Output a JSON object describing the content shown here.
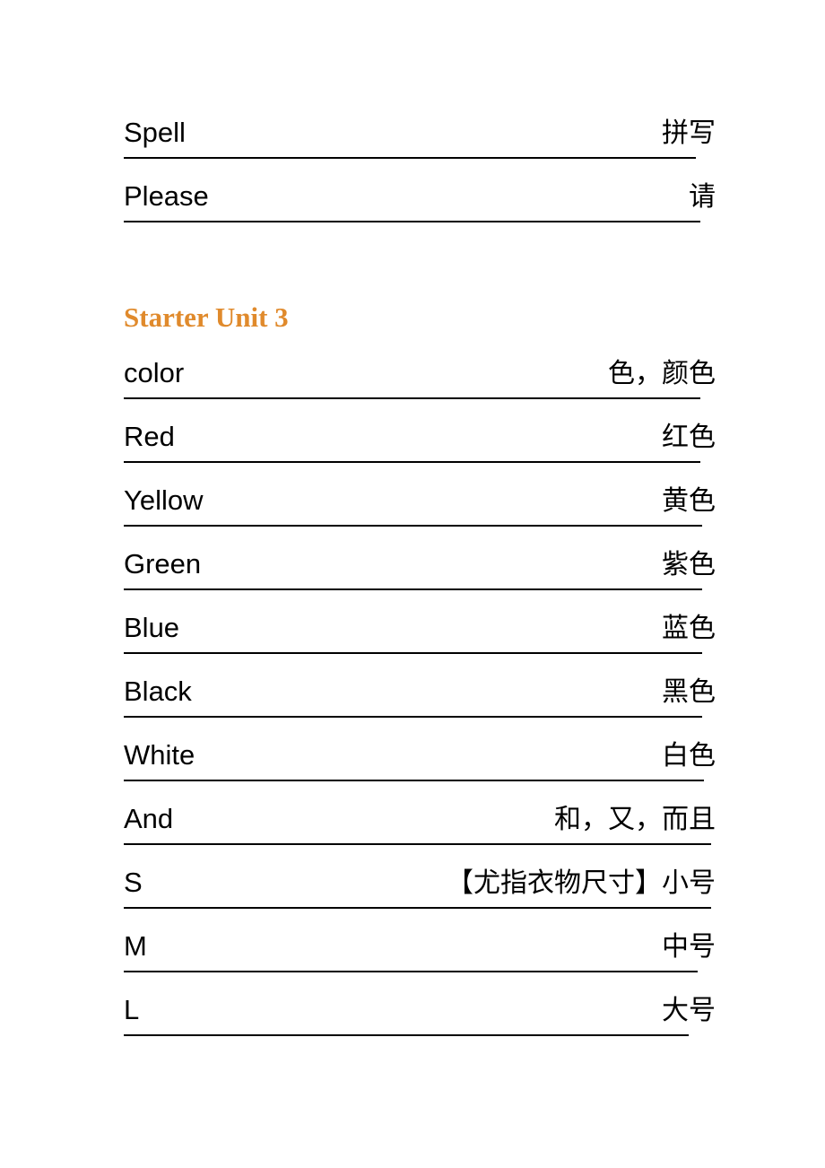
{
  "document": {
    "type": "bilingual-vocabulary-list",
    "language_pair": "English-Chinese",
    "accent_color": "#E08A2C",
    "text_color": "#000000",
    "background_color": "#FFFFFF"
  },
  "blocks": [
    {
      "kind": "row",
      "name": "vocab-row-spell",
      "english": "Spell",
      "chinese": "拼写",
      "rule_width": 638
    },
    {
      "kind": "row",
      "name": "vocab-row-please",
      "english": "Please",
      "chinese": "请",
      "rule_width": 643
    },
    {
      "kind": "gap",
      "name": "section-gap"
    },
    {
      "kind": "heading",
      "name": "section-heading-starter-unit-3",
      "text": "Starter Unit 3"
    },
    {
      "kind": "row",
      "name": "vocab-row-color",
      "english": "color",
      "chinese": "色，颜色",
      "rule_width": 643
    },
    {
      "kind": "row",
      "name": "vocab-row-red",
      "english": "Red",
      "chinese": "红色",
      "rule_width": 643
    },
    {
      "kind": "row",
      "name": "vocab-row-yellow",
      "english": "Yellow",
      "chinese": "黄色",
      "rule_width": 645
    },
    {
      "kind": "row",
      "name": "vocab-row-green",
      "english": "Green",
      "chinese": "紫色",
      "rule_width": 645
    },
    {
      "kind": "row",
      "name": "vocab-row-blue",
      "english": "Blue",
      "chinese": "蓝色",
      "rule_width": 645
    },
    {
      "kind": "row",
      "name": "vocab-row-black",
      "english": "Black",
      "chinese": "黑色",
      "rule_width": 645
    },
    {
      "kind": "row",
      "name": "vocab-row-white",
      "english": "White",
      "chinese": "白色",
      "rule_width": 647
    },
    {
      "kind": "row",
      "name": "vocab-row-and",
      "english": "And",
      "chinese": "和，又，而且",
      "rule_width": 655
    },
    {
      "kind": "row",
      "name": "vocab-row-s",
      "english": "S",
      "chinese": "【尤指衣物尺寸】小号",
      "rule_width": 655
    },
    {
      "kind": "row",
      "name": "vocab-row-m",
      "english": "M",
      "chinese": "中号",
      "rule_width": 640
    },
    {
      "kind": "row",
      "name": "vocab-row-l",
      "english": "L",
      "chinese": "大号",
      "rule_width": 630
    }
  ]
}
